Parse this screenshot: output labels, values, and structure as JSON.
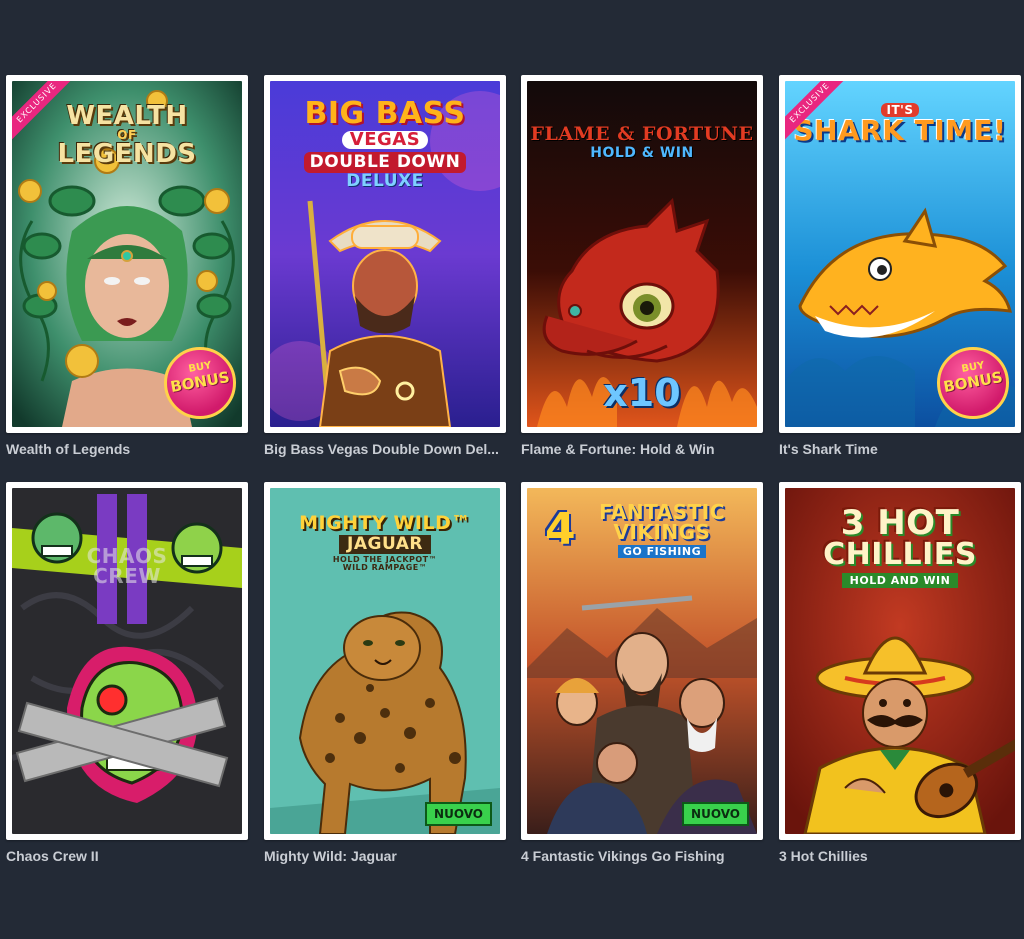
{
  "games": [
    {
      "name": "Wealth of Legends",
      "logo": [
        "WEALTH",
        "OF",
        "LEGENDS"
      ],
      "ribbon": "EXCLUSIVE",
      "badge_top": "BUY",
      "badge_bottom": "BONUS"
    },
    {
      "name": "Big Bass Vegas Double Down Del...",
      "logo": [
        "BIG BASS",
        "VEGAS",
        "DOUBLE DOWN",
        "DELUXE"
      ]
    },
    {
      "name": "Flame & Fortune: Hold & Win",
      "logo": [
        "FLAME & FORTUNE",
        "HOLD & WIN"
      ],
      "multiplier": "x10"
    },
    {
      "name": "It's Shark Time",
      "logo": [
        "IT'S",
        "SHARK TIME!"
      ],
      "ribbon": "EXCLUSIVE",
      "badge_top": "BUY",
      "badge_bottom": "BONUS"
    },
    {
      "name": "Chaos Crew II",
      "logo": [
        "CHAOS",
        "CREW"
      ]
    },
    {
      "name": "Mighty Wild: Jaguar",
      "logo": [
        "MIGHTY WILD™",
        "JAGUAR",
        "HOLD THE JACKPOT™",
        "WILD RAMPAGE™"
      ],
      "new_badge": "NUOVO"
    },
    {
      "name": "4 Fantastic Vikings Go Fishing",
      "logo": [
        "4",
        "FANTASTIC",
        "VIKINGS",
        "GO FISHING"
      ],
      "new_badge": "NUOVO"
    },
    {
      "name": "3 Hot Chillies",
      "logo": [
        "3 HOT",
        "CHILLIES",
        "HOLD AND WIN"
      ]
    }
  ]
}
